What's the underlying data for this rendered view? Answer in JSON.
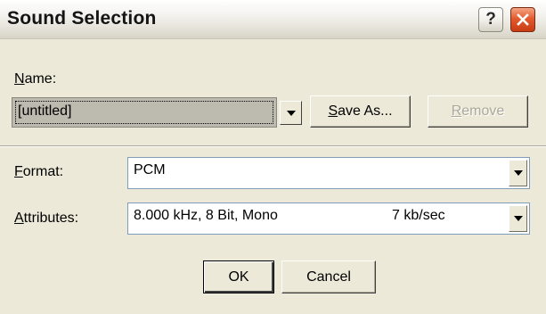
{
  "window": {
    "title": "Sound Selection",
    "help_glyph": "?",
    "icons": {
      "help": "help-icon",
      "close": "close-icon"
    }
  },
  "name": {
    "label_hotkey": "N",
    "label_rest": "ame:",
    "value": "[untitled]"
  },
  "buttons": {
    "save_as_hotkey": "S",
    "save_as_rest": "ave As...",
    "remove_hotkey": "R",
    "remove_rest": "emove",
    "ok": "OK",
    "cancel": "Cancel"
  },
  "format": {
    "label_hotkey": "F",
    "label_rest": "ormat:",
    "value": "PCM"
  },
  "attributes": {
    "label_hotkey": "A",
    "label_rest": "ttributes:",
    "value": "8.000 kHz, 8 Bit, Mono",
    "rate": "7 kb/sec"
  },
  "colors": {
    "face": "#ece9d8",
    "close_button": "#d8491e",
    "field_border": "#7f9db9"
  }
}
